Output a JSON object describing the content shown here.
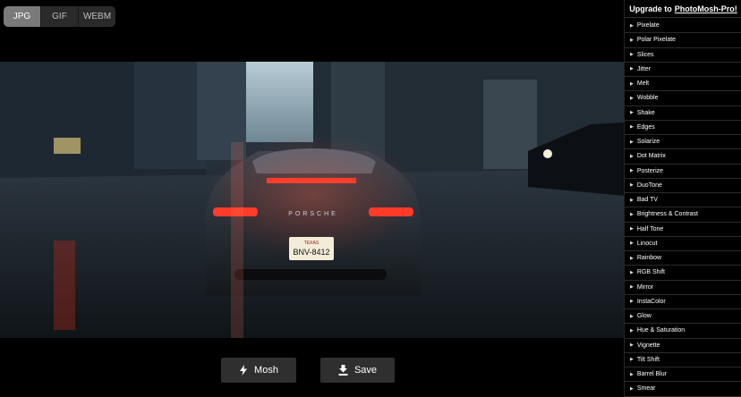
{
  "format_tabs": [
    {
      "label": "JPG",
      "active": true
    },
    {
      "label": "GIF",
      "active": false
    },
    {
      "label": "WEBM",
      "active": false
    }
  ],
  "preview": {
    "plate_text": "BNV-8412",
    "plate_state": "TEXAS",
    "badge_text": "PORSCHE"
  },
  "actions": {
    "mosh_label": "Mosh",
    "save_label": "Save"
  },
  "sidebar": {
    "upgrade_prefix": "Upgrade to",
    "upgrade_link": "PhotoMosh-Pro!",
    "effects": [
      "Pixelate",
      "Polar Pixelate",
      "Slices",
      "Jitter",
      "Melt",
      "Wobble",
      "Shake",
      "Edges",
      "Solarize",
      "Dot Matrix",
      "Posterize",
      "DuoTone",
      "Bad TV",
      "Brightness & Contrast",
      "Half Tone",
      "Linocut",
      "Rainbow",
      "RGB Shift",
      "Mirror",
      "InstaColor",
      "Glow",
      "Hue & Saturation",
      "Vignette",
      "Tilt Shift",
      "Barrel Blur",
      "Smear"
    ]
  },
  "colors": {
    "tab_active": "#7a7a7a",
    "button_bg": "#2f2f2f",
    "taillight": "#ff3b2a"
  }
}
